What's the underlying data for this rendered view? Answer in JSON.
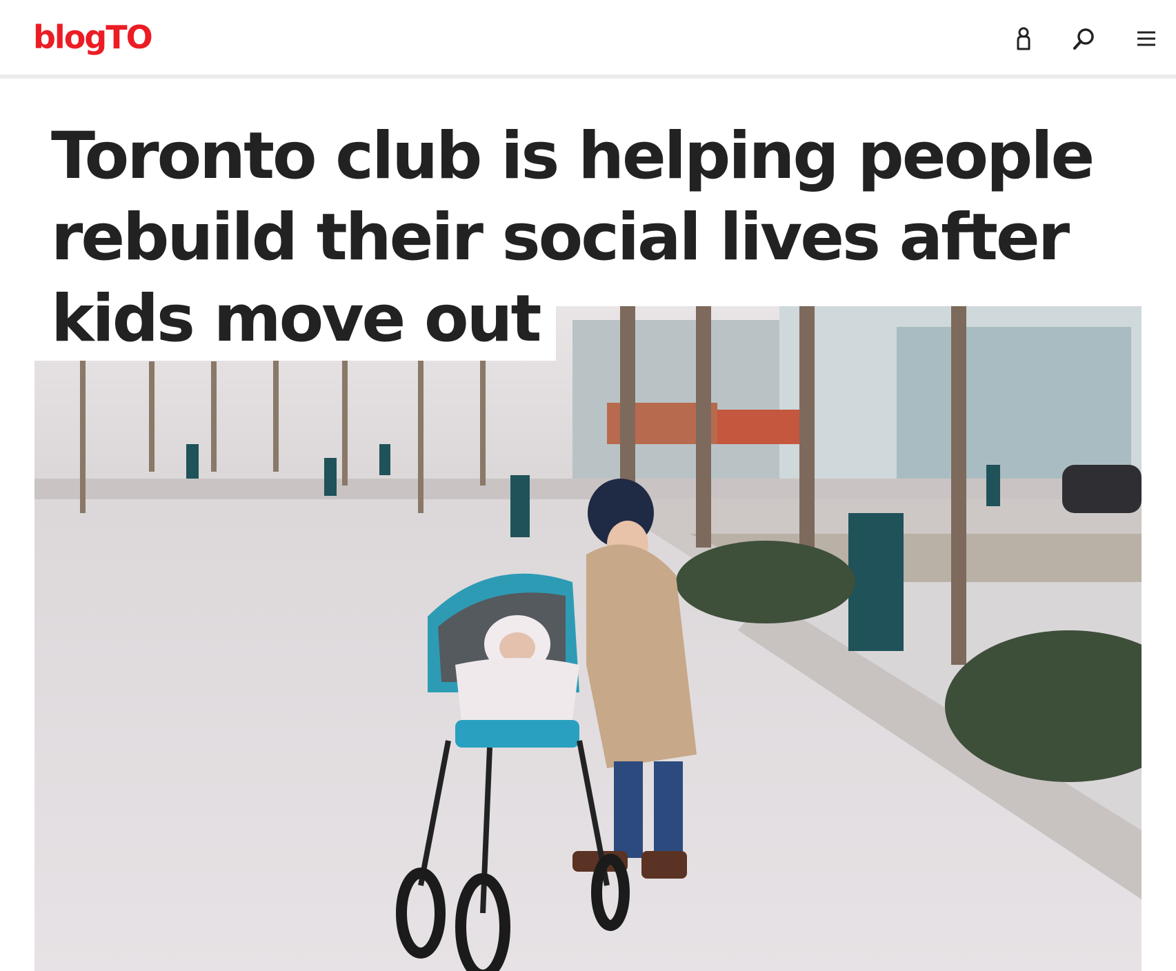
{
  "header": {
    "logo": "blogTO",
    "brand_color": "#ec1c24",
    "icons": [
      "account-icon",
      "search-icon",
      "menu-icon"
    ]
  },
  "article": {
    "headline": "Toronto club is helping people rebuild their social lives after kids move out"
  },
  "hero_image": {
    "description_icon": "photo-woman-with-stroller"
  }
}
